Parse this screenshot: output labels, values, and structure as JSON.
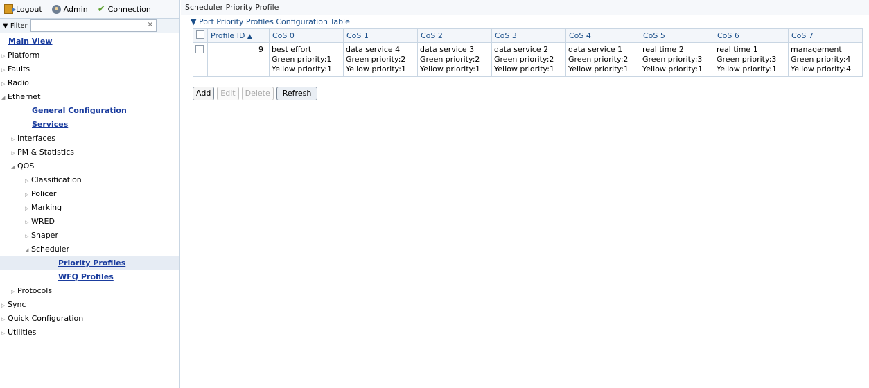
{
  "topbar": {
    "logout": "Logout",
    "admin": "Admin",
    "connection": "Connection"
  },
  "filter": {
    "label": "Filter",
    "value": "",
    "clear": "×"
  },
  "tree": [
    {
      "label": "Main View",
      "indent": 0,
      "arrow": "",
      "link": true
    },
    {
      "label": "Platform",
      "indent": 0,
      "arrow": "▷",
      "link": false
    },
    {
      "label": "Faults",
      "indent": 0,
      "arrow": "▷",
      "link": false
    },
    {
      "label": "Radio",
      "indent": 0,
      "arrow": "▷",
      "link": false
    },
    {
      "label": "Ethernet",
      "indent": 0,
      "arrow": "◢",
      "link": false
    },
    {
      "label": "General Configuration",
      "indent": 1,
      "arrow": "",
      "link": true
    },
    {
      "label": "Services",
      "indent": 1,
      "arrow": "",
      "link": true
    },
    {
      "label": "Interfaces",
      "indent": 1,
      "arrow": "▷",
      "link": false
    },
    {
      "label": "PM & Statistics",
      "indent": 1,
      "arrow": "▷",
      "link": false
    },
    {
      "label": "QOS",
      "indent": 1,
      "arrow": "◢",
      "link": false
    },
    {
      "label": "Classification",
      "indent": 2,
      "arrow": "▷",
      "link": false
    },
    {
      "label": "Policer",
      "indent": 2,
      "arrow": "▷",
      "link": false
    },
    {
      "label": "Marking",
      "indent": 2,
      "arrow": "▷",
      "link": false
    },
    {
      "label": "WRED",
      "indent": 2,
      "arrow": "▷",
      "link": false
    },
    {
      "label": "Shaper",
      "indent": 2,
      "arrow": "▷",
      "link": false
    },
    {
      "label": "Scheduler",
      "indent": 2,
      "arrow": "◢",
      "link": false
    },
    {
      "label": "Priority Profiles",
      "indent": 3,
      "arrow": "",
      "link": true,
      "selected": true
    },
    {
      "label": "WFQ Profiles",
      "indent": 3,
      "arrow": "",
      "link": true
    },
    {
      "label": "Protocols",
      "indent": 1,
      "arrow": "▷",
      "link": false
    },
    {
      "label": "Sync",
      "indent": 0,
      "arrow": "▷",
      "link": false
    },
    {
      "label": "Quick Configuration",
      "indent": 0,
      "arrow": "▷",
      "link": false
    },
    {
      "label": "Utilities",
      "indent": 0,
      "arrow": "▷",
      "link": false
    }
  ],
  "page_title": "Scheduler Priority Profile",
  "section_title": "▼ Port Priority Profiles Configuration Table",
  "table": {
    "headers": [
      "Profile ID",
      "CoS 0",
      "CoS 1",
      "CoS 2",
      "CoS 3",
      "CoS 4",
      "CoS 5",
      "CoS 6",
      "CoS 7"
    ],
    "sort_indicator": "▲",
    "rows": [
      {
        "profile_id": "9",
        "cos": [
          [
            "best effort",
            "Green priority:1",
            "Yellow priority:1"
          ],
          [
            "data service 4",
            "Green priority:2",
            "Yellow priority:1"
          ],
          [
            "data service 3",
            "Green priority:2",
            "Yellow priority:1"
          ],
          [
            "data service 2",
            "Green priority:2",
            "Yellow priority:1"
          ],
          [
            "data service 1",
            "Green priority:2",
            "Yellow priority:1"
          ],
          [
            "real time 2",
            "Green priority:3",
            "Yellow priority:1"
          ],
          [
            "real time 1",
            "Green priority:3",
            "Yellow priority:1"
          ],
          [
            "management",
            "Green priority:4",
            "Yellow priority:4"
          ]
        ]
      }
    ]
  },
  "buttons": {
    "add": "Add",
    "edit": "Edit",
    "delete": "Delete",
    "refresh": "Refresh"
  }
}
